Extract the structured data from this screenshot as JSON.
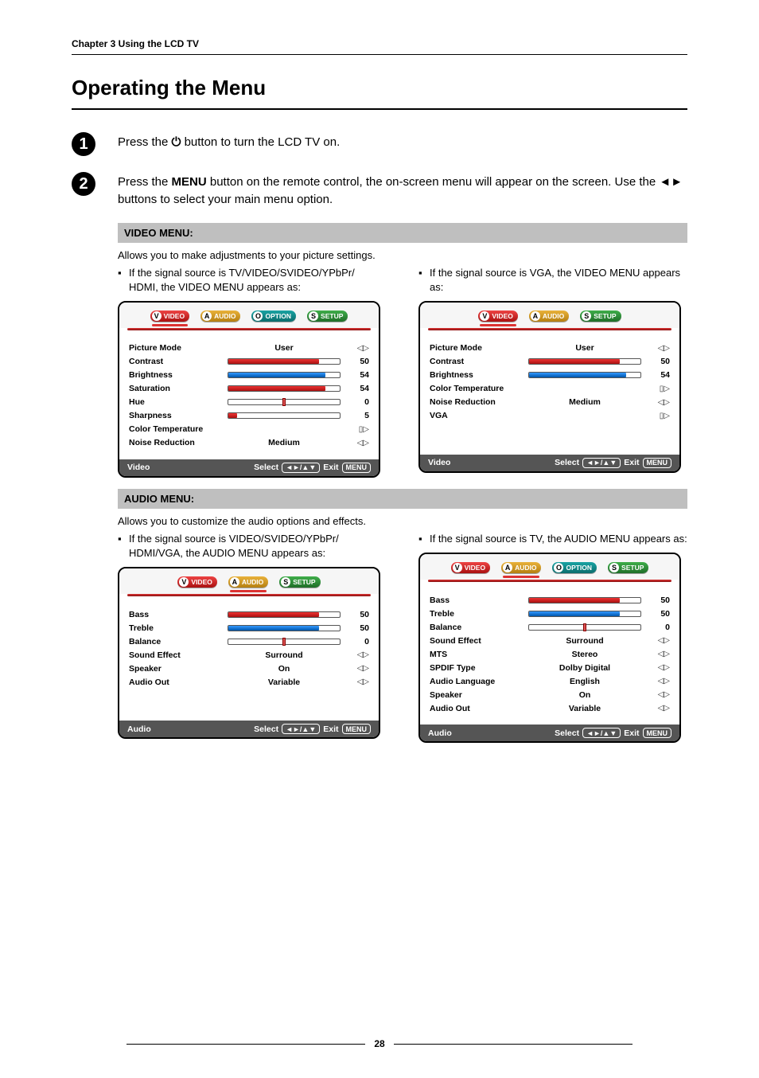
{
  "chapter_header": "Chapter 3 Using the LCD TV",
  "page_title": "Operating the Menu",
  "steps": {
    "1": {
      "pre": "Press the ",
      "icon": "⏻",
      "post": " button to turn the LCD TV on."
    },
    "2": {
      "pre": "Press the ",
      "bold": "MENU",
      "post": " button on the remote control, the on-screen menu will appear on the screen. Use the ◄► buttons to select your main menu option."
    }
  },
  "sections": {
    "video": {
      "bar": "VIDEO MENU:",
      "desc": "Allows you to make adjustments to your picture settings.",
      "left_intro": "If the signal source is TV/VIDEO/SVIDEO/YPbPr/ HDMI, the VIDEO MENU appears as:",
      "right_intro": "If the signal source is VGA, the VIDEO MENU appears as:"
    },
    "audio": {
      "bar": "AUDIO MENU:",
      "desc": "Allows you to customize the audio options and effects.",
      "left_intro": "If the signal source is VIDEO/SVIDEO/YPbPr/ HDMI/VGA, the AUDIO MENU appears as:",
      "right_intro": "If the signal source is TV, the AUDIO MENU appears as:"
    }
  },
  "tab_labels": {
    "video": "VIDEO",
    "audio": "AUDIO",
    "option": "OPTION",
    "setup": "SETUP"
  },
  "tab_icons": {
    "video": "V",
    "audio": "A",
    "option": "O",
    "setup": "S"
  },
  "osd_footer": {
    "select": "Select",
    "keys": "◄►/▲▼",
    "exit": "Exit",
    "menu": "MENU"
  },
  "osd_footer_names": {
    "video": "Video",
    "audio": "Audio"
  },
  "video_full": {
    "rows": [
      {
        "label": "Picture Mode",
        "type": "text",
        "mid": "User",
        "arr": "◁▷"
      },
      {
        "label": "Contrast",
        "type": "bar",
        "color": "red",
        "pct": 80,
        "val": "50"
      },
      {
        "label": "Brightness",
        "type": "bar",
        "color": "blue",
        "pct": 86,
        "val": "54"
      },
      {
        "label": "Saturation",
        "type": "bar",
        "color": "red",
        "pct": 86,
        "val": "54"
      },
      {
        "label": "Hue",
        "type": "tick",
        "tickpct": 50,
        "val": "0"
      },
      {
        "label": "Sharpness",
        "type": "bar",
        "color": "red",
        "pct": 8,
        "val": "5"
      },
      {
        "label": "Color Temperature",
        "type": "arr",
        "arr": "▯▷"
      },
      {
        "label": "Noise Reduction",
        "type": "text",
        "mid": "Medium",
        "arr": "◁▷"
      }
    ]
  },
  "video_vga": {
    "rows": [
      {
        "label": "Picture Mode",
        "type": "text",
        "mid": "User",
        "arr": "◁▷"
      },
      {
        "label": "Contrast",
        "type": "bar",
        "color": "red",
        "pct": 80,
        "val": "50"
      },
      {
        "label": "Brightness",
        "type": "bar",
        "color": "blue",
        "pct": 86,
        "val": "54"
      },
      {
        "label": "Color Temperature",
        "type": "arr",
        "arr": "▯▷"
      },
      {
        "label": "Noise Reduction",
        "type": "text",
        "mid": "Medium",
        "arr": "◁▷"
      },
      {
        "label": "VGA",
        "type": "arr",
        "arr": "▯▷"
      }
    ]
  },
  "audio_basic": {
    "rows": [
      {
        "label": "Bass",
        "type": "bar",
        "color": "red",
        "pct": 80,
        "val": "50"
      },
      {
        "label": "Treble",
        "type": "bar",
        "color": "blue",
        "pct": 80,
        "val": "50"
      },
      {
        "label": "Balance",
        "type": "tick",
        "tickpct": 50,
        "val": "0"
      },
      {
        "label": "Sound Effect",
        "type": "text",
        "mid": "Surround",
        "arr": "◁▷"
      },
      {
        "label": "Speaker",
        "type": "text",
        "mid": "On",
        "arr": "◁▷"
      },
      {
        "label": "Audio Out",
        "type": "text",
        "mid": "Variable",
        "arr": "◁▷"
      }
    ]
  },
  "audio_tv": {
    "rows": [
      {
        "label": "Bass",
        "type": "bar",
        "color": "red",
        "pct": 80,
        "val": "50"
      },
      {
        "label": "Treble",
        "type": "bar",
        "color": "blue",
        "pct": 80,
        "val": "50"
      },
      {
        "label": "Balance",
        "type": "tick",
        "tickpct": 50,
        "val": "0"
      },
      {
        "label": "Sound Effect",
        "type": "text",
        "mid": "Surround",
        "arr": "◁▷"
      },
      {
        "label": "MTS",
        "type": "text",
        "mid": "Stereo",
        "arr": "◁▷"
      },
      {
        "label": "SPDIF Type",
        "type": "text",
        "mid": "Dolby Digital",
        "arr": "◁▷"
      },
      {
        "label": "Audio Language",
        "type": "text",
        "mid": "English",
        "arr": "◁▷"
      },
      {
        "label": "Speaker",
        "type": "text",
        "mid": "On",
        "arr": "◁▷"
      },
      {
        "label": "Audio Out",
        "type": "text",
        "mid": "Variable",
        "arr": "◁▷"
      }
    ]
  },
  "page_number": "28"
}
